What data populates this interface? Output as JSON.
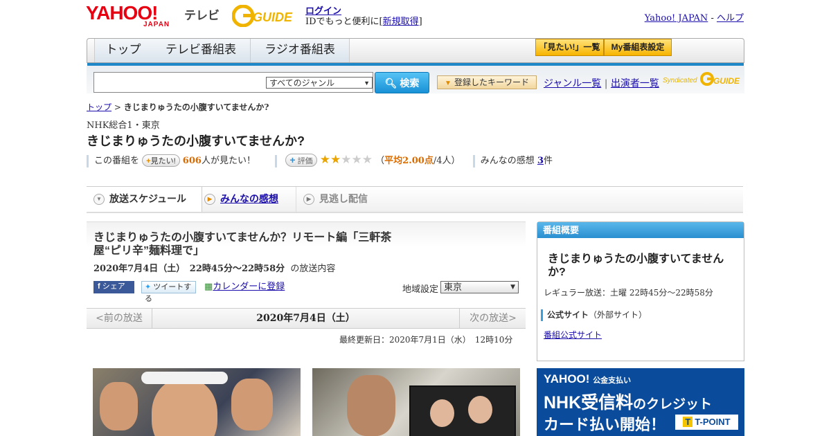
{
  "header": {
    "logo_yahoo": "YAHOO!",
    "logo_japan": "JAPAN",
    "logo_tv": "テレビ",
    "gguide_logo": "G-GUIDE",
    "login": "ログイン",
    "login_sub_prefix": "IDでもっと便利に[",
    "register": "新規取得",
    "login_sub_suffix": "]",
    "yahoo_japan": "Yahoo! JAPAN",
    "sep": " - ",
    "help": "ヘルプ"
  },
  "nav": {
    "tabs": [
      "トップ",
      "テレビ番組表",
      "ラジオ番組表"
    ],
    "mitai_list": "「見たい!」一覧",
    "my_schedule": "My番組表設定"
  },
  "search": {
    "genre_selected": "すべてのジャンル",
    "button": "検索",
    "keyword_button": "登録したキーワード",
    "genre_list": "ジャンル一覧",
    "divider": "|",
    "performer_list": "出演者一覧",
    "syndicated": "Syndicated"
  },
  "breadcrumb": {
    "top": "トップ",
    "sep": " > ",
    "current": "きじまりゅうたの小腹すいてませんか?"
  },
  "program": {
    "channel": "NHK総合1・東京",
    "title": "きじまりゅうたの小腹すいてませんか?",
    "kono_bangumi": "この番組を",
    "mitai_btn": "見たい!",
    "mitai_count": "606",
    "mitai_suffix": "人が見たい！",
    "rate_btn": "評価",
    "rating_value": 2,
    "rating_max": 5,
    "rating_open": "（",
    "average": "平均2.00点",
    "rating_count": "/4人）",
    "comments_label": "みんなの感想",
    "comments_count": "3",
    "comments_unit": "件"
  },
  "tabs": {
    "schedule": "放送スケジュール",
    "reviews": "みんなの感想",
    "missed": "見逃し配信"
  },
  "episode": {
    "title": "きじまりゅうたの小腹すいてませんか？リモート編「三軒茶屋“ピリ辛”麺料理で」",
    "datetime": "2020年7月4日（土）　22時45分～22時58分",
    "datetime_suffix": "の放送内容",
    "share_fb": "シェア",
    "share_tw": "ツイートする",
    "calendar": "カレンダーに登録",
    "region_label": "地域設定",
    "region_value": "東京",
    "prev": "<前の放送",
    "current_date": "2020年7月4日（土）",
    "next": "次の放送>",
    "updated": "最終更新日：2020年7月1日（水）　12時10分"
  },
  "sidebar": {
    "heading": "番組概要",
    "title": "きじまりゅうたの小腹すいてませんか?",
    "regular": "レギュラー放送：土曜 22時45分～22時58分",
    "official_label": "公式サイト",
    "official_note": "（外部サイト）",
    "official_link": "番組公式サイト"
  },
  "ad": {
    "yahoo": "YAHOO!",
    "japan": "JAPAN",
    "service": "公金支払い",
    "line1_a": "NHK受信料",
    "line1_b": "のクレジット",
    "line2": "カード払い開始！",
    "tpoint_badge": "T",
    "tpoint": "T-POINT"
  },
  "colors": {
    "brand_red": "#e60012",
    "nav_blue": "#1d87c8",
    "accent_orange": "#d96b00",
    "star": "#e9a400",
    "ad_blue": "#0b4b9b"
  }
}
